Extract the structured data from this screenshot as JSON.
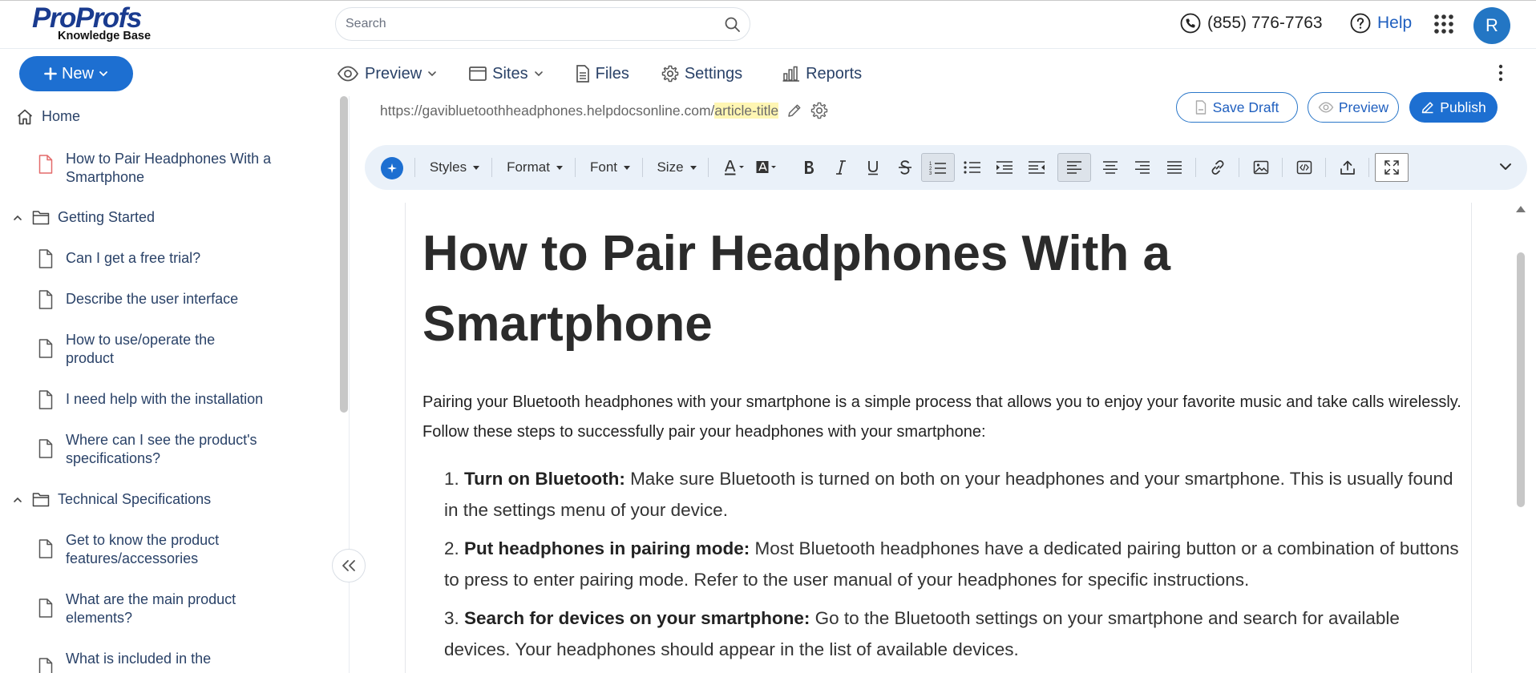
{
  "header": {
    "logo_brand": "ProProfs",
    "logo_sub": "Knowledge Base",
    "search_placeholder": "Search",
    "phone": "(855) 776-7763",
    "help_label": "Help",
    "avatar_initial": "R"
  },
  "toolbar_top": {
    "new_label": "New",
    "nav": [
      {
        "label": "Preview",
        "icon": "eye-icon"
      },
      {
        "label": "Sites",
        "icon": "window-icon"
      },
      {
        "label": "Files",
        "icon": "file-icon"
      },
      {
        "label": "Settings",
        "icon": "gear-icon"
      },
      {
        "label": "Reports",
        "icon": "bar-chart-icon"
      }
    ]
  },
  "sidebar": {
    "home_label": "Home",
    "items": [
      {
        "label": "How to Pair Headphones With a Smartphone",
        "type": "article",
        "active": true
      },
      {
        "label": "Getting Started",
        "type": "folder"
      },
      {
        "label": "Can I get a free trial?",
        "type": "article"
      },
      {
        "label": "Describe the user interface",
        "type": "article"
      },
      {
        "label": "How to use/operate the product",
        "type": "article"
      },
      {
        "label": "I need help with the installation",
        "type": "article"
      },
      {
        "label": "Where can I see the product's specifications?",
        "type": "article"
      },
      {
        "label": "Technical Specifications",
        "type": "folder"
      },
      {
        "label": "Get to know the product features/accessories",
        "type": "article"
      },
      {
        "label": "What are the main product elements?",
        "type": "article"
      },
      {
        "label": "What is included in the",
        "type": "article"
      }
    ]
  },
  "editor": {
    "url_base": "https://gavibluetoothheadphones.helpdocsonline.com/",
    "url_slug": "article-title",
    "save_draft_label": "Save Draft",
    "preview_label": "Preview",
    "publish_label": "Publish",
    "format_menus": [
      "Styles",
      "Format",
      "Font",
      "Size"
    ]
  },
  "article": {
    "title": "How to Pair Headphones With a Smartphone",
    "intro": "Pairing your Bluetooth headphones with your smartphone is a simple process that allows you to enjoy your favorite music and take calls wirelessly. Follow these steps to successfully pair your headphones with your smartphone:",
    "steps": [
      {
        "num": "1.",
        "bold": "Turn on Bluetooth:",
        "text": " Make sure Bluetooth is turned on both on your headphones and your smartphone. This is usually found in the settings menu of your device."
      },
      {
        "num": "2.",
        "bold": "Put headphones in pairing mode:",
        "text": " Most Bluetooth headphones have a dedicated pairing button or a combination of buttons to press to enter pairing mode. Refer to the user manual of your headphones for specific instructions."
      },
      {
        "num": "3.",
        "bold": "Search for devices on your smartphone:",
        "text": " Go to the Bluetooth settings on your smartphone and search for available devices. Your headphones should appear in the list of available devices."
      }
    ]
  },
  "colors": {
    "primary": "#1d6fd1",
    "nav_text": "#2a4268",
    "toolbar_bg": "#eaf1f9",
    "slug_highlight": "#fff6b3"
  }
}
